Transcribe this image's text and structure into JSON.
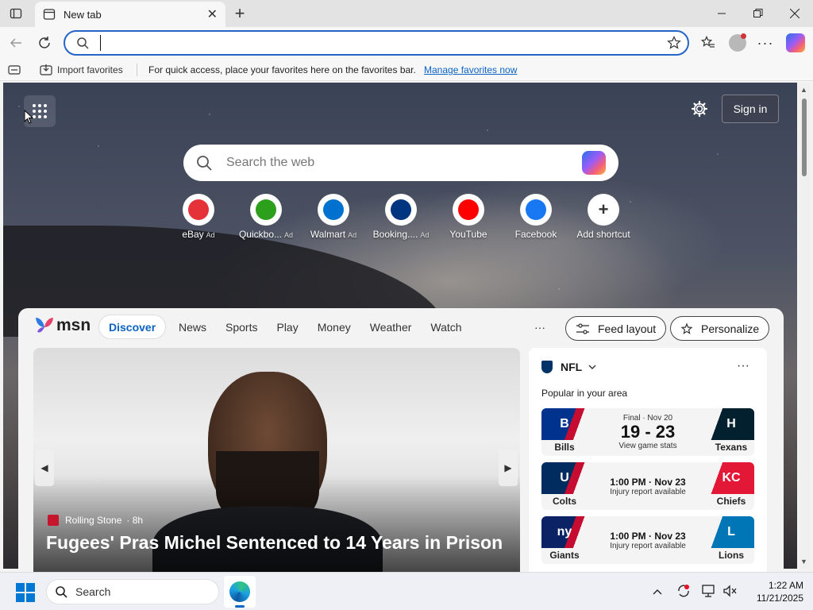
{
  "browser": {
    "tab_title": "New tab",
    "address_value": "",
    "favbar": {
      "import_label": "Import favorites",
      "message": "For quick access, place your favorites here on the favorites bar.",
      "manage_link": "Manage favorites now"
    }
  },
  "newtab": {
    "search_placeholder": "Search the web",
    "sign_in": "Sign in",
    "shortcuts": [
      {
        "label": "eBay",
        "ad": "Ad",
        "icon": "ebay-icon",
        "color": "#e53238"
      },
      {
        "label": "Quickbo...",
        "ad": "Ad",
        "icon": "quickbooks-icon",
        "color": "#2ca01c"
      },
      {
        "label": "Walmart",
        "ad": "Ad",
        "icon": "walmart-icon",
        "color": "#0071ce"
      },
      {
        "label": "Booking....",
        "ad": "Ad",
        "icon": "booking-icon",
        "color": "#003580"
      },
      {
        "label": "YouTube",
        "ad": "",
        "icon": "youtube-icon",
        "color": "#ff0000"
      },
      {
        "label": "Facebook",
        "ad": "",
        "icon": "facebook-icon",
        "color": "#1877f2"
      },
      {
        "label": "Add shortcut",
        "ad": "",
        "icon": "plus-icon",
        "color": "#333333"
      }
    ]
  },
  "feed": {
    "logo": "msn",
    "tabs": [
      "Discover",
      "News",
      "Sports",
      "Play",
      "Money",
      "Weather",
      "Watch"
    ],
    "more": "···",
    "feed_layout": "Feed layout",
    "personalize": "Personalize",
    "hero": {
      "source": "Rolling Stone",
      "age": "· 8h",
      "headline": "Fugees' Pras Michel Sentenced to 14 Years in Prison"
    }
  },
  "nfl": {
    "title": "NFL",
    "subtitle": "Popular in your area",
    "games": [
      {
        "home": "Bills",
        "away": "Texans",
        "status": "Final · Nov 20",
        "score": "19 - 23",
        "note": "View game stats",
        "home_color": "#00338d",
        "away_color": "#03202f",
        "home_abbr": "B",
        "away_abbr": "H"
      },
      {
        "home": "Colts",
        "away": "Chiefs",
        "status": "",
        "score": "1:00 PM · Nov 23",
        "note": "Injury report available",
        "home_color": "#002c5f",
        "away_color": "#e31837",
        "home_abbr": "U",
        "away_abbr": "KC"
      },
      {
        "home": "Giants",
        "away": "Lions",
        "status": "",
        "score": "1:00 PM · Nov 23",
        "note": "Injury report available",
        "home_color": "#0b2265",
        "away_color": "#0076b6",
        "home_abbr": "ny",
        "away_abbr": "L"
      }
    ]
  },
  "taskbar": {
    "search": "Search",
    "time": "1:22 AM",
    "date": "11/21/2025"
  }
}
